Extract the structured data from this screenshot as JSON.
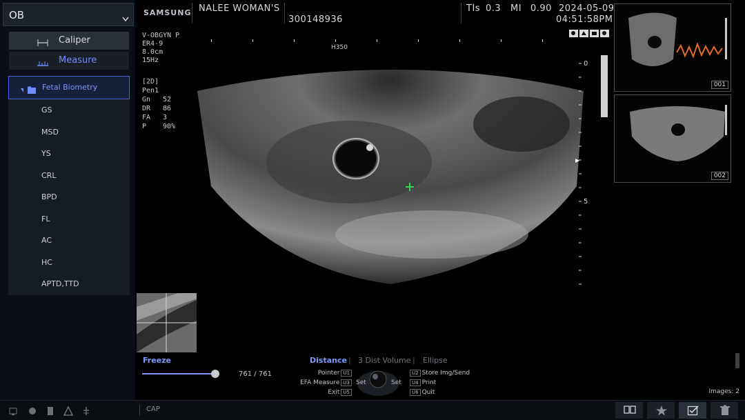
{
  "header": {
    "brand": "SAMSUNG",
    "institution": "NALEE WOMAN'S",
    "patient_id": "300148936",
    "tis_label": "TIs",
    "tis_value": "0.3",
    "mi_label": "MI",
    "mi_value": "0.90",
    "date": "2024-05-09",
    "time": "04:51:58PM"
  },
  "left_panel": {
    "mode": "OB",
    "caliper_label": "Caliper",
    "measure_label": "Measure",
    "folder_label": "Fetal Biometry",
    "items": [
      "GS",
      "MSD",
      "YS",
      "CRL",
      "BPD",
      "FL",
      "AC",
      "HC",
      "APTD,TTD"
    ]
  },
  "image_info": {
    "preset": "V-OBGYN P",
    "probe": "ER4-9",
    "depth": "8.0cm",
    "rate": "15Hz",
    "mode_tag": "[2D]",
    "pen": "Pen1",
    "params": [
      {
        "label": "Gn",
        "value": "52"
      },
      {
        "label": "DR",
        "value": "86"
      },
      {
        "label": "FA",
        "value": "3"
      },
      {
        "label": "P",
        "value": "90%"
      }
    ],
    "depth_top": "0",
    "depth_mid": "5",
    "top_marker": "H350"
  },
  "thumbnails": [
    {
      "number": "001"
    },
    {
      "number": "002"
    }
  ],
  "controls": {
    "freeze_label": "Freeze",
    "cine_current": "761",
    "cine_total": "761",
    "cine_separator": "/",
    "cine_position": 1.0,
    "tabs": [
      "Distance",
      "3 Dist Volume",
      "Ellipse"
    ],
    "tab_separator": "|",
    "left_keys": [
      {
        "label": "Pointer",
        "tag": "U1"
      },
      {
        "label": "EFA Measure",
        "tag": "U3"
      },
      {
        "label": "Exit",
        "tag": "U5"
      }
    ],
    "right_keys": [
      {
        "tag": "U2",
        "label": "Store Img/Send"
      },
      {
        "tag": "U4",
        "label": "Print"
      },
      {
        "tag": "U6",
        "label": "Quit"
      }
    ],
    "trackball_left": "Set",
    "trackball_right": "Set",
    "images_count": "Images: 2"
  },
  "status_bar": {
    "cap_label": "CAP"
  },
  "colors": {
    "accent": "#6f8dff",
    "caliper_cross": "#2fd85a"
  }
}
